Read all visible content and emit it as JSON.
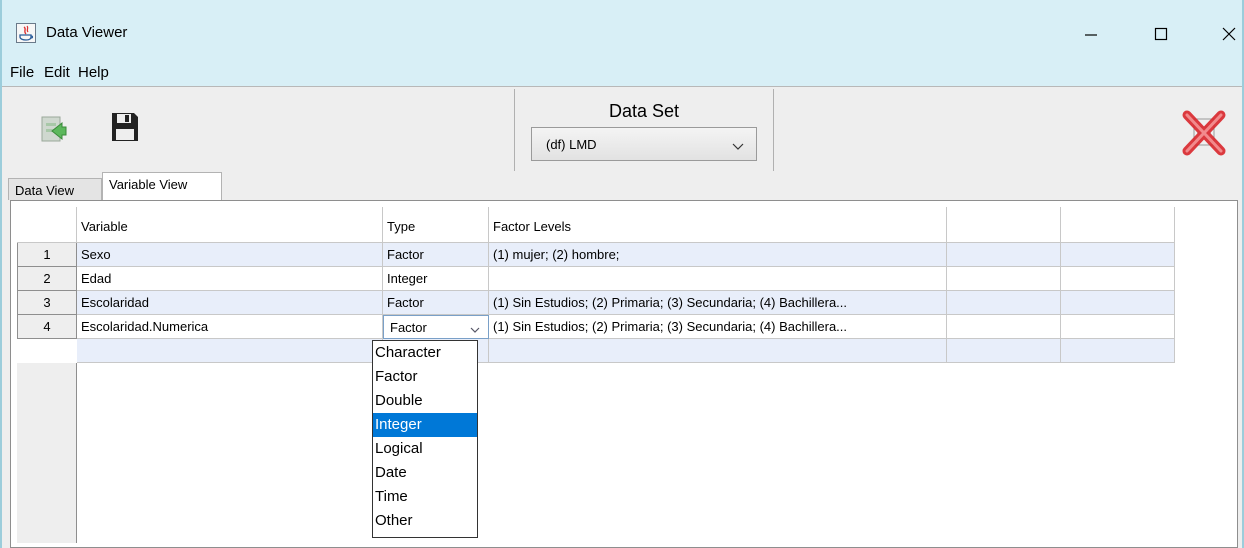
{
  "window": {
    "title": "Data Viewer"
  },
  "menu": [
    "File",
    "Edit",
    "Help"
  ],
  "dataset": {
    "label": "Data Set",
    "selected": "(df) LMD"
  },
  "tabs": [
    "Data View",
    "Variable View"
  ],
  "table": {
    "headers": [
      "Variable",
      "Type",
      "Factor Levels",
      "",
      ""
    ],
    "rows": [
      {
        "num": "1",
        "variable": "Sexo",
        "type": "Factor",
        "levels": "(1) mujer; (2) hombre;"
      },
      {
        "num": "2",
        "variable": "Edad",
        "type": "Integer",
        "levels": ""
      },
      {
        "num": "3",
        "variable": "Escolaridad",
        "type": "Factor",
        "levels": "(1) Sin Estudios; (2) Primaria; (3) Secundaria; (4) Bachillera..."
      },
      {
        "num": "4",
        "variable": "Escolaridad.Numerica",
        "type": "Factor",
        "levels": "(1) Sin Estudios; (2) Primaria; (3) Secundaria; (4) Bachillera..."
      }
    ]
  },
  "type_dropdown": {
    "options": [
      "Character",
      "Factor",
      "Double",
      "Integer",
      "Logical",
      "Date",
      "Time",
      "Other"
    ],
    "highlighted": "Integer"
  },
  "colors": {
    "titlebar": "#d8eff6",
    "selection": "#0078d7",
    "row_alt": "#e8eefa",
    "close_red": "#d9262b"
  }
}
